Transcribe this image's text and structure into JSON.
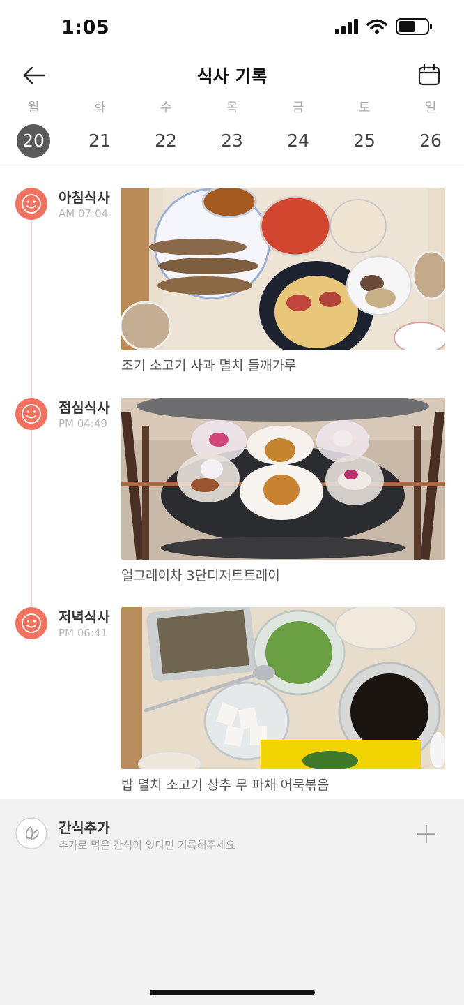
{
  "status_bar": {
    "time": "1:05",
    "battery_level": 0.6
  },
  "header": {
    "title": "식사 기록",
    "back_icon": "back-arrow-icon",
    "calendar_icon": "calendar-icon"
  },
  "week": {
    "days": [
      {
        "dow": "월",
        "num": "20",
        "selected": true
      },
      {
        "dow": "화",
        "num": "21"
      },
      {
        "dow": "수",
        "num": "22"
      },
      {
        "dow": "목",
        "num": "23"
      },
      {
        "dow": "금",
        "num": "24"
      },
      {
        "dow": "토",
        "num": "25"
      },
      {
        "dow": "일",
        "num": "26"
      }
    ]
  },
  "meals": [
    {
      "title": "아침식사",
      "time": "AM 07:04",
      "description": "조기 소고기 사과 멸치 들깨가루",
      "icon": "smile-face-icon"
    },
    {
      "title": "점심식사",
      "time": "PM 04:49",
      "description": "얼그레이차 3단디저트트레이",
      "icon": "smile-face-icon"
    },
    {
      "title": "저녁식사",
      "time": "PM 06:41",
      "description": "밥 멸치 소고기 상추 무 파채 어묵볶음",
      "icon": "smile-face-icon"
    }
  ],
  "snack": {
    "title": "간식추가",
    "subtitle": "추가로 먹은 간식이 있다면 기록해주세요",
    "icon": "leaf-icon",
    "add_icon": "plus-icon"
  },
  "colors": {
    "accent": "#f2725f",
    "selected_day": "#5a5a5a",
    "timeline": "#f0d6d2"
  }
}
